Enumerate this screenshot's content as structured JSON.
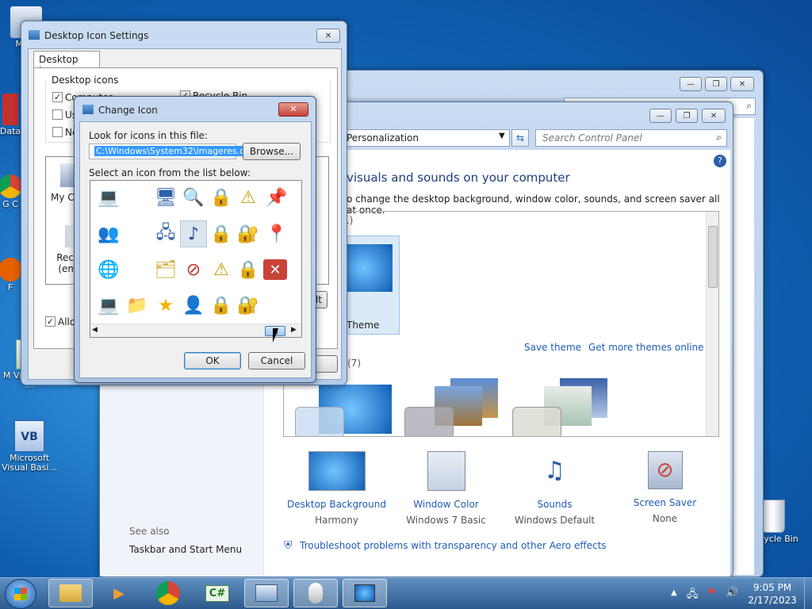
{
  "desktop": {
    "icons": [
      {
        "label": "My C"
      },
      {
        "label": "Data"
      },
      {
        "label": "G C"
      },
      {
        "label": "F"
      },
      {
        "label": "M Visual C# ..."
      },
      {
        "label": "Microsoft Visual Basi..."
      },
      {
        "label": "Recycle Bin"
      }
    ]
  },
  "control_panel": {
    "title_controls": [
      "—",
      "❐",
      "✕"
    ],
    "breadcrumb": "Personalization",
    "search_placeholder": "Search Control Panel",
    "heading": "visuals and sounds on your computer",
    "subheading": "o change the desktop background, window color, sounds, and screen saver all at once.",
    "my_themes_count": "1)",
    "theme_name": "Theme",
    "save_theme": "Save theme",
    "get_more_themes": "Get more themes online",
    "aero_count": "(7)",
    "bottom_items": [
      {
        "label": "Desktop Background",
        "value": "Harmony"
      },
      {
        "label": "Window Color",
        "value": "Windows 7 Basic"
      },
      {
        "label": "Sounds",
        "value": "Windows Default"
      },
      {
        "label": "Screen Saver",
        "value": "None"
      }
    ],
    "see_also": "See also",
    "taskbar_link": "Taskbar and Start Menu",
    "troubleshoot": "Troubleshoot problems with transparency and other Aero effects"
  },
  "desktop_icon_settings": {
    "title": "Desktop Icon Settings",
    "tab": "Desktop Icons",
    "group_label": "Desktop icons",
    "checkboxes": [
      {
        "label": "Computer",
        "checked": true
      },
      {
        "label": "Recycle Bin",
        "checked": true
      },
      {
        "label": "Use",
        "checked": false
      },
      {
        "label": "Ne",
        "checked": false
      }
    ],
    "preview_labels": [
      "My Co",
      "Recyc (emp"
    ],
    "allow_label": "Allow",
    "partial_button": "lt"
  },
  "change_icon": {
    "title": "Change Icon",
    "look_label": "Look for icons in this file:",
    "file_path": "C:\\Windows\\System32\\imageres.dll",
    "browse": "Browse...",
    "select_label": "Select an icon from the list below:",
    "ok": "OK",
    "cancel": "Cancel"
  },
  "taskbar": {
    "time": "9:05 PM",
    "date": "2/17/2023"
  },
  "colors": {
    "link": "#1e5cb8",
    "selection": "#3399ff",
    "close_red": "#c8433a"
  }
}
